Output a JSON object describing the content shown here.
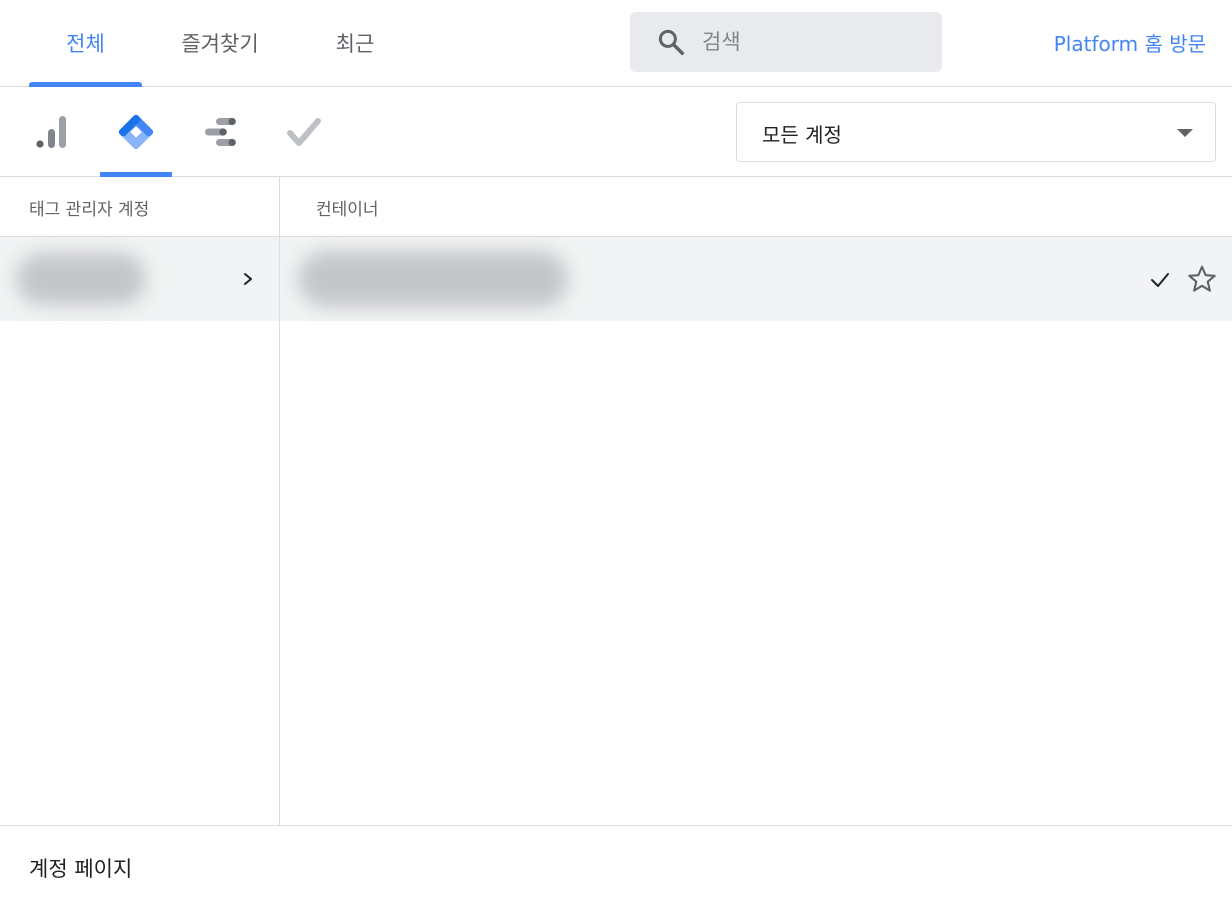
{
  "tabs": {
    "all": "전체",
    "favorites": "즐겨찾기",
    "recent": "최근"
  },
  "search": {
    "placeholder": "검색",
    "value": ""
  },
  "platform_link": "Platform 홈 방문",
  "products": [
    {
      "name": "analytics",
      "icon": "analytics-bar-icon"
    },
    {
      "name": "tag-manager",
      "icon": "tag-manager-icon",
      "selected": true
    },
    {
      "name": "data-studio",
      "icon": "data-studio-icon"
    },
    {
      "name": "optimize",
      "icon": "optimize-check-icon"
    }
  ],
  "account_filter": {
    "selected": "모든 계정"
  },
  "columns": {
    "accounts": "태그 관리자 계정",
    "containers": "컨테이너"
  },
  "footer": {
    "account_page": "계정 페이지"
  },
  "colors": {
    "accent": "#4285f4",
    "row_bg": "#f1f3f4",
    "border": "#dadce0"
  }
}
